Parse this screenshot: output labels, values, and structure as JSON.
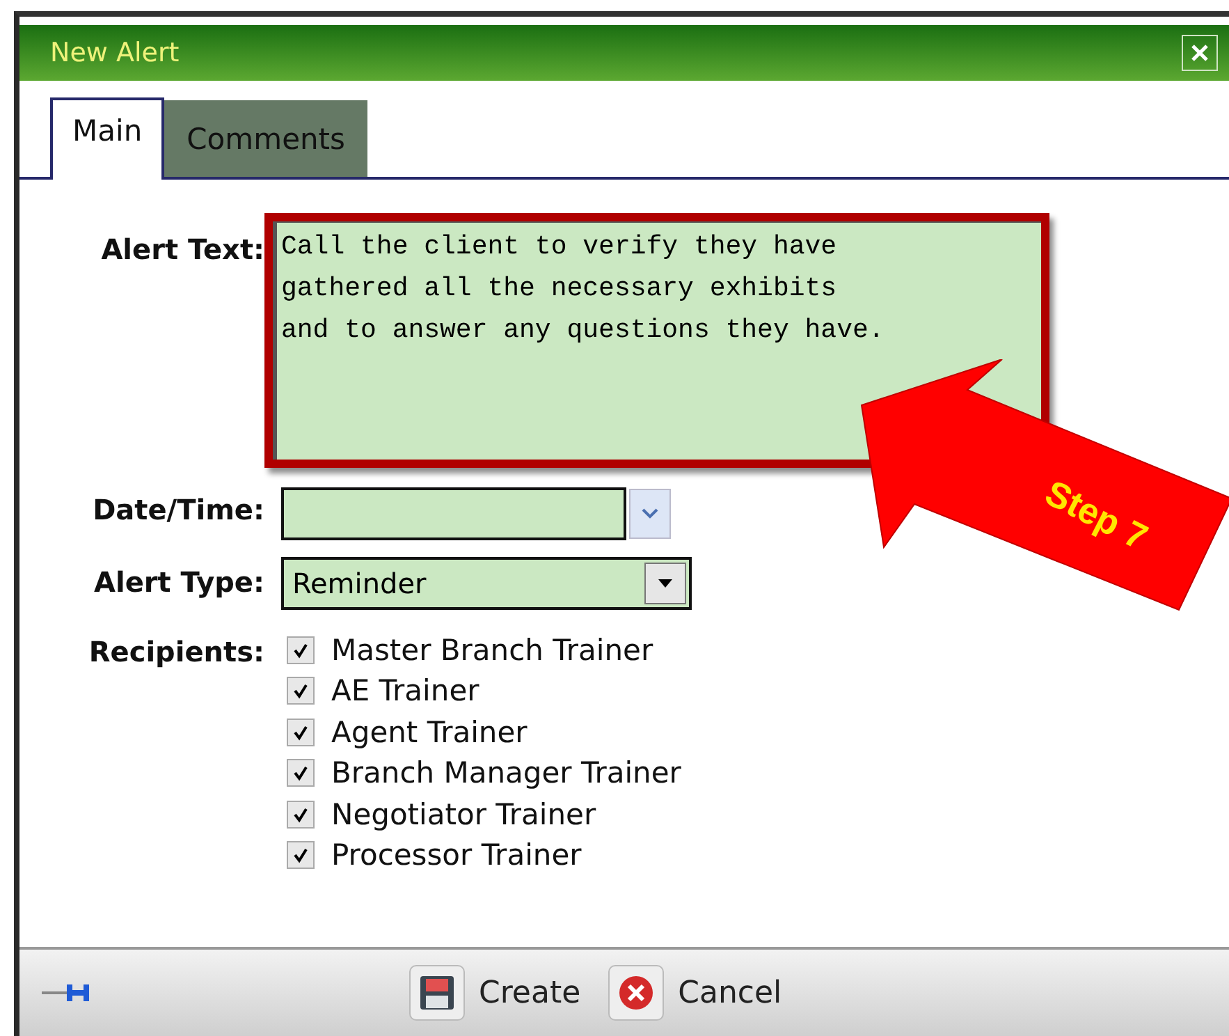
{
  "window": {
    "title": "New Alert"
  },
  "tabs": [
    {
      "label": "Main",
      "selected": true
    },
    {
      "label": "Comments",
      "selected": false
    }
  ],
  "form": {
    "alert_text": {
      "label": "Alert Text:",
      "value": "Call the client to verify they have\ngathered all the necessary exhibits\nand to answer any questions they have.",
      "highlighted": true
    },
    "date_time": {
      "label": "Date/Time:"
    },
    "alert_type": {
      "label": "Alert Type:",
      "value": "Reminder"
    },
    "recipients": {
      "label": "Recipients:",
      "items": [
        {
          "label": "Master Branch Trainer",
          "checked": true
        },
        {
          "label": "AE Trainer",
          "checked": true
        },
        {
          "label": "Agent Trainer",
          "checked": true
        },
        {
          "label": "Branch Manager Trainer",
          "checked": true
        },
        {
          "label": "Negotiator Trainer",
          "checked": true
        },
        {
          "label": "Processor Trainer",
          "checked": true
        }
      ]
    }
  },
  "buttons": [
    {
      "label": "Create",
      "kind": "save"
    },
    {
      "label": "Cancel",
      "kind": "cancel"
    }
  ],
  "annotation": {
    "text": "Step 7"
  }
}
